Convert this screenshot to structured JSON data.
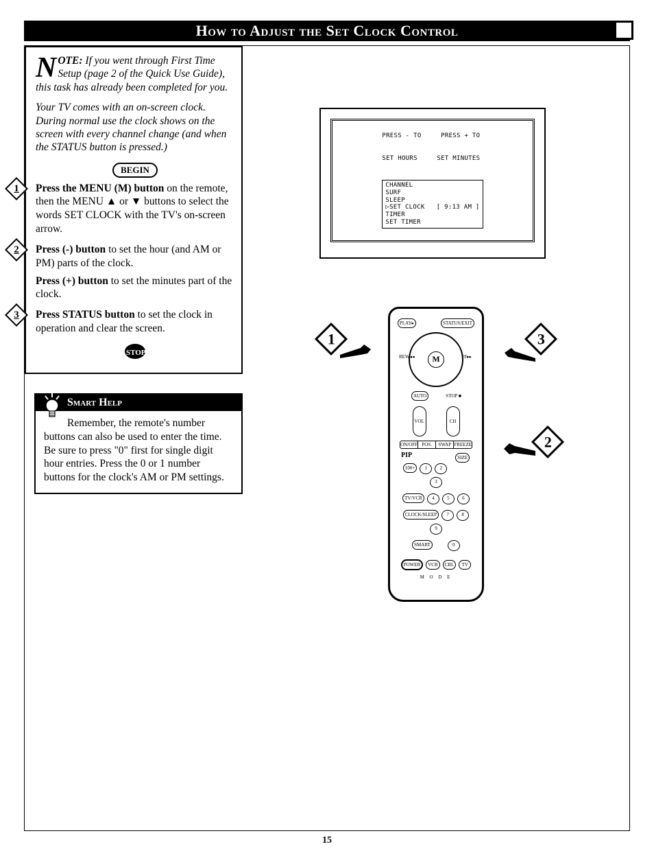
{
  "title": "How to Adjust the Set Clock Control",
  "note": {
    "dropcap": "N",
    "label": "OTE:",
    "body_line": "If you went through First Time Setup (page 2 of the Quick Use Guide), this task has already been completed for you."
  },
  "intro": "Your TV comes with an on-screen clock. During normal use the clock shows on the screen with every channel change (and when the STATUS button is pressed.)",
  "begin_label": "BEGIN",
  "stop_label": "STOP",
  "steps": [
    {
      "n": "1",
      "lead": "Press the MENU (M) button",
      "rest": " on the remote, then the MENU ▲ or ▼ buttons to select the words SET CLOCK with the TV's on-screen arrow."
    },
    {
      "n": "2",
      "lead": "Press (-) button",
      "rest": " to set the hour (and AM or PM) parts of the clock.",
      "lead2": "Press (+) button",
      "rest2": " to set the minutes part of the clock."
    },
    {
      "n": "3",
      "lead": "Press STATUS button",
      "rest": " to set the clock in operation and clear the screen."
    }
  ],
  "smart": {
    "title": "Smart Help",
    "body": "Remember, the remote's number buttons can also be used to enter the time. Be sure to press \"0\" first for single digit hour entries. Press the 0 or 1 number buttons for the clock's AM or PM settings."
  },
  "tv_screen": {
    "line1": "PRESS - TO     PRESS + TO",
    "line2": "SET HOURS     SET MINUTES",
    "menu": "CHANNEL\nSURF\nSLEEP\n▷SET CLOCK   [ 9:13 AM ]\nTIMER\nSET TIMER"
  },
  "remote": {
    "top_row": [
      "PLAY▸",
      "STATUS/EXIT"
    ],
    "side_labels": [
      "REW◂◂",
      "FF▸▸"
    ],
    "stop_label": "STOP ■",
    "auto_label": "AUTO",
    "vol": "VOL",
    "ch": "CH",
    "bar": [
      "ON/OFF",
      "POS.",
      "SWAP",
      "FREEZE"
    ],
    "pip": "PIP",
    "size": "SIZE",
    "row_buttons": [
      "100+",
      "1",
      "2",
      "3",
      "TV/VCR",
      "4",
      "5",
      "6",
      "CLOCK/SLEEP",
      "7",
      "8",
      "9",
      "SMART",
      "",
      "0",
      ""
    ],
    "power": "POWER",
    "mode_row": [
      "VCR",
      "CBL",
      "TV"
    ],
    "mode_label": "M   O   D   E"
  },
  "callouts": [
    "1",
    "2",
    "3"
  ],
  "page_number": "15"
}
